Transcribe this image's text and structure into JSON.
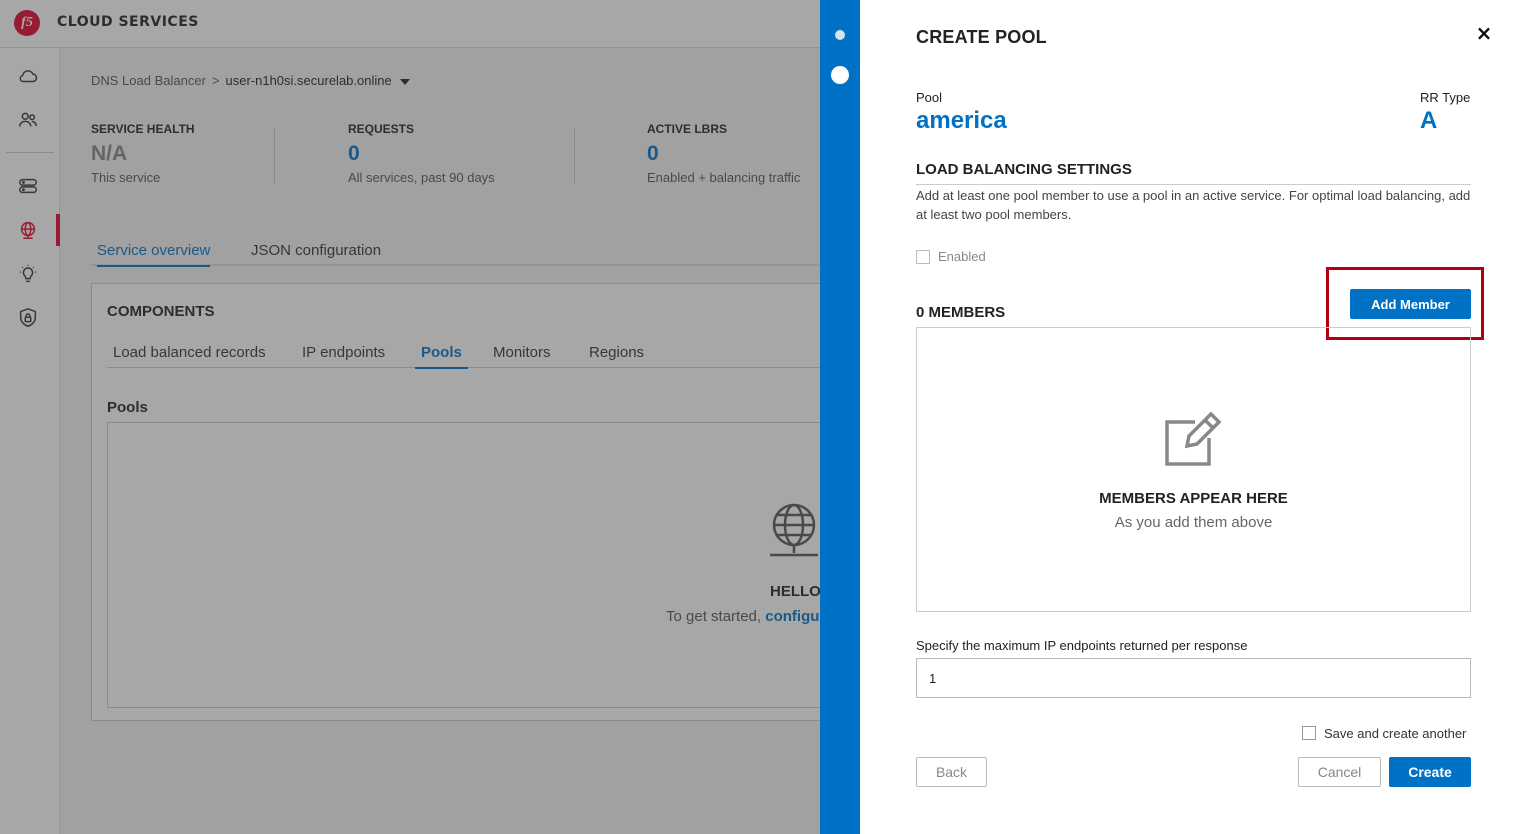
{
  "app": {
    "brand_logo": "f5",
    "brand_name": "CLOUD SERVICES",
    "nav_icons": [
      "cloud-icon",
      "users-icon",
      "server-icon",
      "globe-icon",
      "bulb-icon",
      "shield-icon"
    ]
  },
  "breadcrumb": {
    "parent": "DNS Load Balancer",
    "separator": ">",
    "current": "user-n1h0si.securelab.online"
  },
  "stats": [
    {
      "label": "SERVICE HEALTH",
      "value": "N/A",
      "sub": "This service"
    },
    {
      "label": "REQUESTS",
      "value": "0",
      "sub": "All services, past 90 days"
    },
    {
      "label": "ACTIVE LBRS",
      "value": "0",
      "sub": "Enabled + balancing traffic"
    }
  ],
  "main_tabs": [
    "Service overview",
    "JSON configuration"
  ],
  "components": {
    "title": "COMPONENTS",
    "tabs": [
      "Load balanced records",
      "IP endpoints",
      "Pools",
      "Monitors",
      "Regions"
    ],
    "active_tab": "Pools",
    "pools_label": "Pools",
    "empty_title": "HELLO",
    "empty_text": "To get started,",
    "empty_link": "configu"
  },
  "panel": {
    "title": "CREATE POOL",
    "close": "×",
    "pool_label": "Pool",
    "pool_value": "america",
    "rr_label": "RR Type",
    "rr_value": "A",
    "lbs_title": "LOAD BALANCING SETTINGS",
    "lbs_desc": "Add at least one pool member to use a pool in an active service. For optimal load balancing, add at least two pool members.",
    "enabled_label": "Enabled",
    "members_title": "0 MEMBERS",
    "add_member": "Add Member",
    "members_empty_title": "MEMBERS APPEAR HERE",
    "members_empty_sub": "As you add them above",
    "max_label": "Specify the maximum IP endpoints returned per response",
    "max_value": "1",
    "save_another": "Save and create another",
    "back": "Back",
    "cancel": "Cancel",
    "create": "Create"
  },
  "colors": {
    "accent": "#0072c6",
    "brand": "#e4002b",
    "highlight": "#b00010"
  }
}
